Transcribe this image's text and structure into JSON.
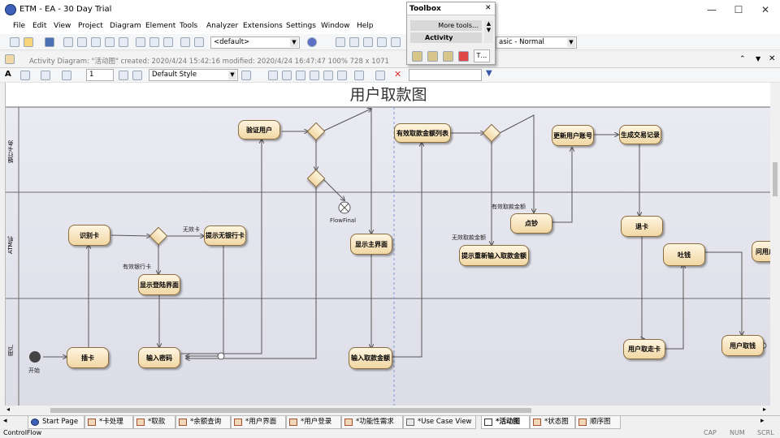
{
  "window": {
    "title": "ETM - EA - 30 Day Trial",
    "min_glyph": "—",
    "max_glyph": "☐",
    "close_glyph": "✕"
  },
  "menu": [
    "File",
    "Edit",
    "View",
    "Project",
    "Diagram",
    "Element",
    "Tools",
    "Analyzer",
    "Extensions",
    "Settings",
    "Window",
    "Help"
  ],
  "toolbar1": {
    "perspective_value": "<default>",
    "style_value": "asic - Normal"
  },
  "toolbox": {
    "title": "Toolbox",
    "close_glyph": "✕",
    "more_tools": "More tools…",
    "section": "Activity",
    "tab_label": "T…"
  },
  "info": {
    "text": "Activity Diagram: \"活动图\"  created: 2020/4/24 15:42:16  modified: 2020/4/24 16:47:47  100%  728 x 1071"
  },
  "toolbar3": {
    "line_width": "1",
    "style_value": "Default Style"
  },
  "diagram": {
    "title": "用户取款图",
    "lanes": [
      "银行卡务",
      "ATM机",
      "用户"
    ],
    "nodes": {
      "verify_user": "验证用户",
      "valid_accounts": "有效取款金额列表",
      "update_balance": "更新用户账号",
      "gen_record": "生成交易记录",
      "read_card": "识别卡",
      "invalid_card_notice": "提示无银行卡",
      "show_main": "显示主界面",
      "count_cash": "点钞",
      "re_enter_notice": "提示重新输入取款金额",
      "return_card": "退卡",
      "dispense": "吐钱",
      "user_partial": "问用户",
      "show_login": "显示登陆界面",
      "insert_card": "插卡",
      "enter_pin": "输入密码",
      "enter_amount": "输入取款金额",
      "take_card": "用户取走卡",
      "take_cash": "用户取钱"
    },
    "labels": {
      "flow_final": "FlowFinal",
      "start": "开始",
      "invalid_card": "无效卡",
      "valid_card": "有效银行卡",
      "valid_amount": "有效取款金额",
      "invalid_amount": "无效取款金额"
    }
  },
  "tabs": [
    {
      "label": "Start Page",
      "active": false
    },
    {
      "label": "*卡处理",
      "active": false
    },
    {
      "label": "*取款",
      "active": false
    },
    {
      "label": "*余额查询",
      "active": false
    },
    {
      "label": "*用户界面",
      "active": false
    },
    {
      "label": "*用户登录",
      "active": false
    },
    {
      "label": "*功能性需求",
      "active": false
    },
    {
      "label": "*Use Case View",
      "active": false
    },
    {
      "label": "*活动图",
      "active": true
    },
    {
      "label": "*状态图",
      "active": false
    },
    {
      "label": "顺序图",
      "active": false
    }
  ],
  "status": {
    "left": "ControlFlow",
    "caps": "CAP",
    "num": "NUM",
    "scrl": "SCRL"
  }
}
